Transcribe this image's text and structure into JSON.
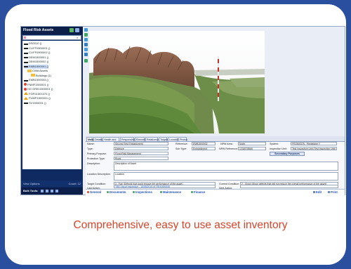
{
  "caption": "Comprehensive, easy to use asset inventory",
  "left_panel": {
    "title": "Flood Risk Assets",
    "tree": [
      {
        "label": "DS0010 ()",
        "glyph": "g-blk",
        "indent": 0
      },
      {
        "label": "CLIFF0000001 ()",
        "glyph": "g-blk",
        "indent": 0
      },
      {
        "label": "CLIFF0000002 ()",
        "glyph": "g-blk",
        "indent": 0
      },
      {
        "label": "DEM1500001 ()",
        "glyph": "g-blk",
        "indent": 0
      },
      {
        "label": "DEM1500002 ()",
        "glyph": "g-blk",
        "indent": 0
      },
      {
        "label": "EMB1500001 ()",
        "glyph": "g-blk",
        "indent": 0,
        "selected": true
      },
      {
        "label": "Child Assets",
        "glyph": "g-fold",
        "indent": 1
      },
      {
        "label": "Buildings (1)",
        "glyph": "g-fold",
        "indent": 2
      },
      {
        "label": "EMB1500003 ()",
        "glyph": "g-blk",
        "indent": 0
      },
      {
        "label": "FNMF1500001 ()",
        "glyph": "g-red",
        "indent": 0
      },
      {
        "label": "HG GRID1500001 ()",
        "glyph": "g-red",
        "indent": 0
      },
      {
        "label": "FGR41501070 ()",
        "glyph": "g-tri",
        "indent": 0
      },
      {
        "label": "PUMP1500001 ()",
        "glyph": "g-tri",
        "indent": 0
      },
      {
        "label": "SV1500001 ()",
        "glyph": "g-blk",
        "indent": 0
      }
    ],
    "view_options": "View Options",
    "count": "Count: 12",
    "bulk_tools": "Bulk Tools:"
  },
  "tabs": [
    "Main",
    "Details",
    "Health and Safety",
    "Responsibilities",
    "Elements",
    "Relationships",
    "Targets",
    "Location",
    "Photos"
  ],
  "active_tab": "Main",
  "form": {
    "name_label": "Name:",
    "name": "Second Test Embankment",
    "reference_label": "Reference:",
    "reference": "EMB1500002",
    "npw_area_label": "NPW Area:",
    "npw_area": "North",
    "system_label": "System:",
    "system": "FR/26/5375 - Peebegine Y",
    "type_label": "Type:",
    "type": "Defence",
    "subtype_label": "Sub Type:",
    "subtype": "Embankment",
    "npw_ref_label": "NPW Reference:",
    "npw_ref": "1234578566",
    "inspection_unit_label": "Inspection Unit:",
    "inspection_unit": "Test Inspection Unit (Test Inspection Unit)",
    "primary_purpose_label": "Primary Purpose:",
    "primary_purpose": "Flood Risk Management",
    "secondary_purposes": "Secondary Purposes",
    "protection_type_label": "Protection Type:",
    "protection_type": "Rural",
    "description_label": "Description:",
    "description": "Description of Asset",
    "location_description_label": "Location Description:",
    "location_description": "Location",
    "target_condition_label": "Target Condition:",
    "target_condition": "3 - Fair (Defects that could reduce the performance of the asset)",
    "current_condition_label": "Current Condition:",
    "current_condition": "2 - Good (Minor defects that will not reduce the overall performance of the asset)",
    "last_action_label": "Last Action:",
    "last_action": "TBB Visual Inspection - 15/05/2015 of TRH1500006",
    "next_action_label": "Next Action:",
    "next_action": ""
  },
  "bottom_bar": {
    "general": "General",
    "documents": "Documents",
    "inspections": "Inspections",
    "maintenance": "Maintenance",
    "finance": "Finance",
    "edit": "Edit",
    "print": "Print"
  }
}
